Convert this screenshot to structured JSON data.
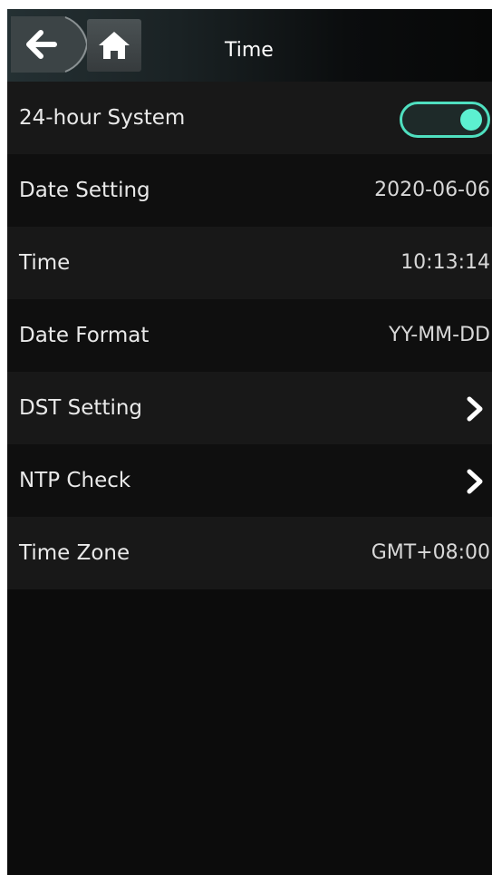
{
  "header": {
    "title": "Time",
    "back_icon": "arrow-left-icon",
    "home_icon": "home-icon"
  },
  "colors": {
    "accent": "#5cf0d0",
    "background": "#0c0c0c",
    "text": "#e9e9e9"
  },
  "settings": [
    {
      "label": "24-hour System",
      "control": "toggle",
      "toggle_on": true
    },
    {
      "label": "Date Setting",
      "value": "2020-06-06"
    },
    {
      "label": "Time",
      "value": "10:13:14"
    },
    {
      "label": "Date Format",
      "value": "YY-MM-DD"
    },
    {
      "label": "DST Setting",
      "control": "chevron-right-icon"
    },
    {
      "label": "NTP Check",
      "control": "chevron-right-icon"
    },
    {
      "label": "Time Zone",
      "value": "GMT+08:00"
    }
  ]
}
